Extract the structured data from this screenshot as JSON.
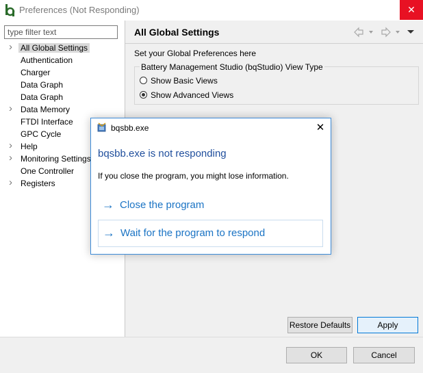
{
  "window": {
    "title": "Preferences (Not Responding)",
    "close_glyph": "✕"
  },
  "filter": {
    "placeholder": "type filter text"
  },
  "tree": {
    "items": [
      {
        "label": "All Global Settings",
        "expandable": true,
        "selected": true
      },
      {
        "label": "Authentication",
        "expandable": false
      },
      {
        "label": "Charger",
        "expandable": false
      },
      {
        "label": "Data Graph",
        "expandable": false
      },
      {
        "label": "Data Graph",
        "expandable": false
      },
      {
        "label": "Data Memory",
        "expandable": true
      },
      {
        "label": "FTDI Interface",
        "expandable": false
      },
      {
        "label": "GPC Cycle",
        "expandable": false
      },
      {
        "label": "Help",
        "expandable": true
      },
      {
        "label": "Monitoring Settings",
        "expandable": true
      },
      {
        "label": "One Controller",
        "expandable": false
      },
      {
        "label": "Registers",
        "expandable": true
      }
    ]
  },
  "page": {
    "title": "All Global Settings",
    "description": "Set your Global Preferences here",
    "group_label": "Battery Management Studio (bqStudio) View Type",
    "options": {
      "basic": "Show Basic Views",
      "advanced": "Show Advanced Views"
    },
    "selected_option": "advanced"
  },
  "buttons": {
    "restore_defaults": "Restore Defaults",
    "apply": "Apply",
    "ok": "OK",
    "cancel": "Cancel"
  },
  "dialog": {
    "title": "bqsbb.exe",
    "close_glyph": "✕",
    "heading": "bqsbb.exe is not responding",
    "message": "If you close the program, you might lose information.",
    "options": {
      "close": "Close the program",
      "wait": "Wait for the program to respond"
    },
    "arrow_glyph": "→"
  },
  "icons": {
    "app": "bq-app-icon",
    "back": "back-arrow-icon",
    "forward": "forward-arrow-icon",
    "menu": "view-menu-icon"
  },
  "colors": {
    "close_button": "#e81123",
    "dialog_link": "#1a73c4",
    "dialog_heading": "#1f4e9c",
    "apply_border": "#0078d7"
  }
}
